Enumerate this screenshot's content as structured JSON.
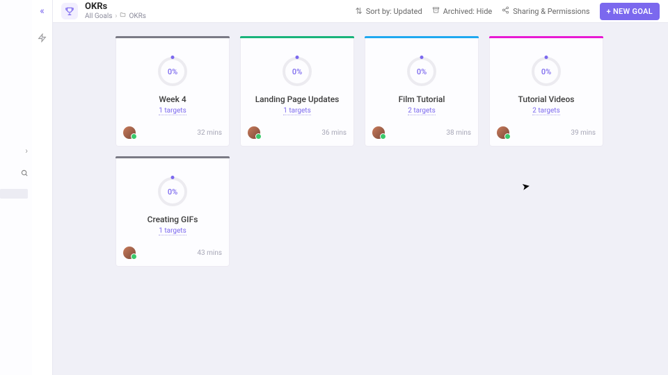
{
  "header": {
    "title": "OKRs",
    "breadcrumb": {
      "root": "All Goals",
      "folder": "OKRs"
    },
    "sort_label": "Sort by: Updated",
    "archived_label": "Archived: Hide",
    "sharing_label": "Sharing & Permissions",
    "new_goal_label": "+ NEW GOAL"
  },
  "colors": {
    "grey": "#7a7a85",
    "green": "#19b37a",
    "blue": "#1fa8f0",
    "pink": "#e819d3"
  },
  "cards": [
    {
      "stripe": "grey",
      "progress": "0%",
      "title": "Week 4",
      "targets": "1 targets",
      "time": "32 mins"
    },
    {
      "stripe": "green",
      "progress": "0%",
      "title": "Landing Page Updates",
      "targets": "1 targets",
      "time": "36 mins"
    },
    {
      "stripe": "blue",
      "progress": "0%",
      "title": "Film Tutorial",
      "targets": "2 targets",
      "time": "38 mins"
    },
    {
      "stripe": "pink",
      "progress": "0%",
      "title": "Tutorial Videos",
      "targets": "2 targets",
      "time": "39 mins"
    },
    {
      "stripe": "grey",
      "progress": "0%",
      "title": "Creating GIFs",
      "targets": "1 targets",
      "time": "43 mins"
    }
  ]
}
